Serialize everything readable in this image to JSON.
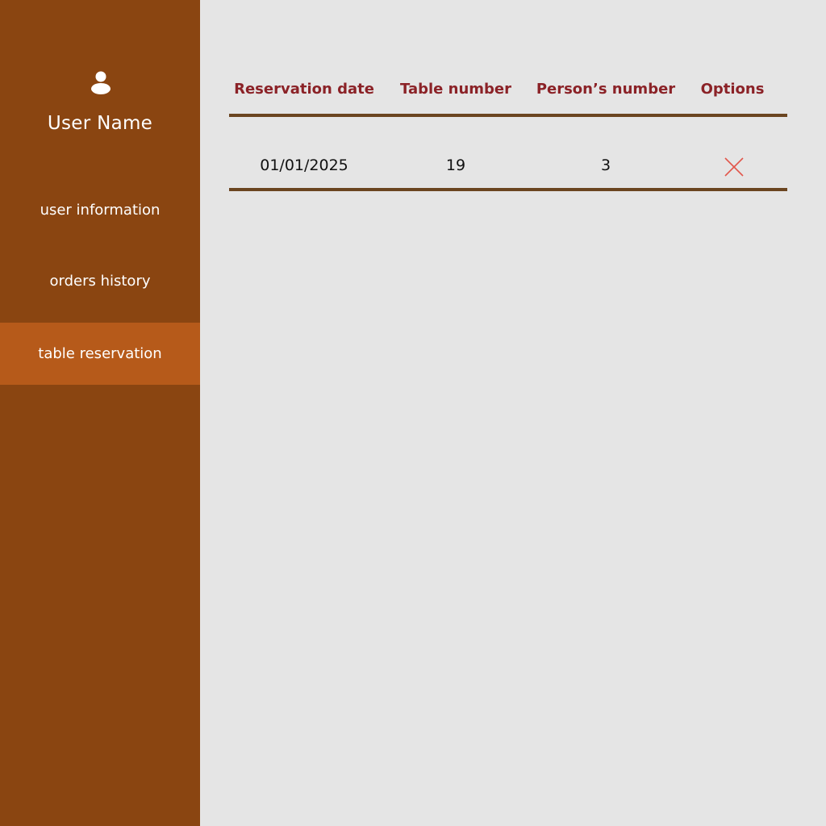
{
  "sidebar": {
    "user_icon": "user-icon",
    "user_name": "User Name",
    "items": [
      {
        "label": "user information",
        "active": false
      },
      {
        "label": "orders history",
        "active": false
      },
      {
        "label": "table reservation",
        "active": true
      }
    ]
  },
  "table": {
    "columns": [
      "Reservation date",
      "Table number",
      "Person’s number",
      "Options"
    ],
    "rows": [
      {
        "date": "01/01/2025",
        "table_number": "19",
        "persons": "3",
        "option_icon": "close-icon"
      }
    ]
  },
  "colors": {
    "sidebar_bg": "#8a4511",
    "sidebar_active": "#b65a1a",
    "header_text": "#8b2227",
    "rule": "#6b4520",
    "delete_icon": "#e2574c",
    "background": "#e5e5e5"
  }
}
